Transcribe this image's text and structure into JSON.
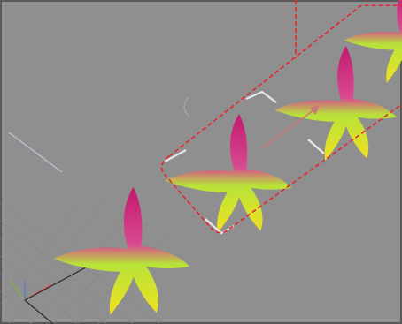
{
  "viewport": {
    "view_name": "",
    "background_color": "#8f8f8f",
    "border_color": "#5a5a5a",
    "grid_color": "#7f8791"
  },
  "callout": {
    "color": "#e8242b",
    "style": "dashed"
  },
  "butterflies": {
    "count": 4,
    "gradient_top": "#c2196f",
    "gradient_mid": "#b7e23a",
    "gradient_bottom": "#f2e11e"
  },
  "gizmo": {
    "axis_x_color": "#d9534f",
    "axis_y_color": "#7fb84a",
    "axis_z_color": "#5b7fd6",
    "move_arrow_color": "#c87a7a"
  }
}
